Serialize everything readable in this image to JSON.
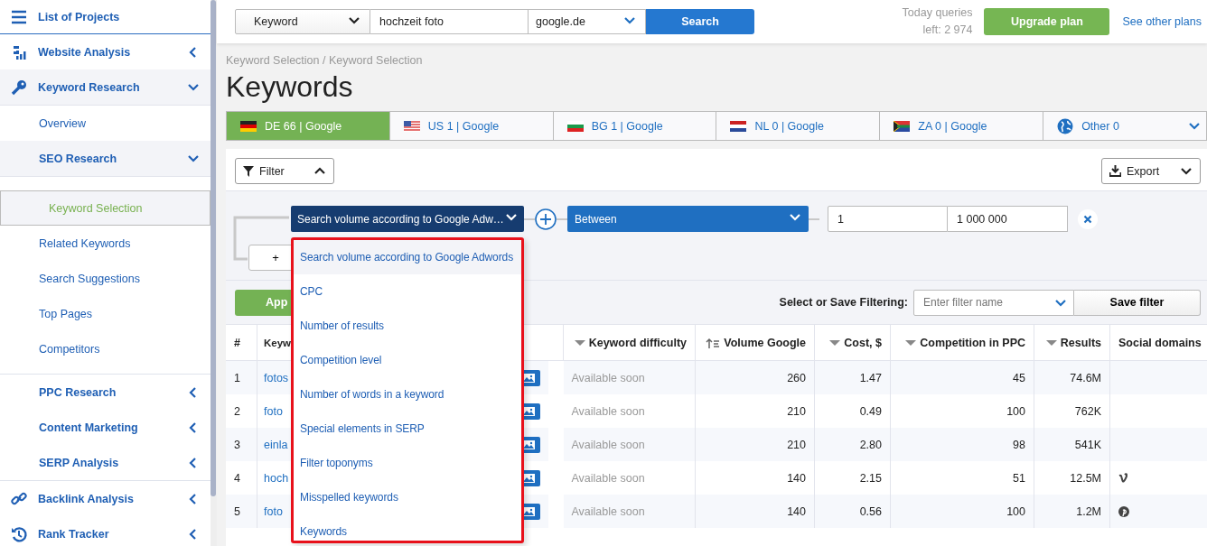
{
  "sidebar": {
    "items": [
      {
        "label": "List of Projects"
      },
      {
        "label": "Website Analysis",
        "expanded": false
      },
      {
        "label": "Keyword Research",
        "expanded": true,
        "children": [
          {
            "label": "Overview"
          },
          {
            "label": "SEO Research",
            "expanded": true,
            "children": [
              {
                "label": "Keyword Selection",
                "selected": true
              },
              {
                "label": "Related Keywords",
                "selected": false
              },
              {
                "label": "Search Suggestions",
                "selected": false
              },
              {
                "label": "Top Pages",
                "selected": false
              },
              {
                "label": "Competitors",
                "selected": false
              }
            ]
          },
          {
            "label": "PPC Research",
            "expanded": false
          },
          {
            "label": "Content Marketing",
            "expanded": false
          },
          {
            "label": "SERP Analysis",
            "expanded": false
          }
        ]
      },
      {
        "label": "Backlink Analysis",
        "expanded": false
      },
      {
        "label": "Rank Tracker",
        "expanded": false
      }
    ]
  },
  "search_bar": {
    "type_select": "Keyword",
    "query": "hochzeit foto",
    "engine": "google.de",
    "button": "Search"
  },
  "quota": {
    "line_1": "Today queries",
    "line_2": "left: 2 974"
  },
  "upgrade_button": "Upgrade plan",
  "plans_link": "See other plans",
  "breadcrumb": "Keyword Selection / Keyword Selection",
  "title": "Keywords",
  "tabs": [
    {
      "label": "DE 66 | Google",
      "selected": true
    },
    {
      "label": "US 1 | Google",
      "selected": false
    },
    {
      "label": "BG 1 | Google",
      "selected": false
    },
    {
      "label": "NL 0 | Google",
      "selected": false
    },
    {
      "label": "ZA 0 | Google",
      "selected": false
    },
    {
      "label": "Other 0",
      "selected": false
    }
  ],
  "filter_button": "Filter",
  "export_button": "Export",
  "filter_row": {
    "field": "Search volume according to Google Adw…",
    "operator": "Between",
    "from": "1",
    "to": "1 000 000",
    "add_button": "+"
  },
  "field_dropdown": {
    "options": [
      {
        "label": "Search volume according to Google Adwords",
        "selected": true
      },
      {
        "label": "CPC",
        "selected": false
      },
      {
        "label": "Number of results",
        "selected": false
      },
      {
        "label": "Competition level",
        "selected": false
      },
      {
        "label": "Number of words in a keyword",
        "selected": false
      },
      {
        "label": "Special elements in SERP",
        "selected": false
      },
      {
        "label": "Filter toponyms",
        "selected": false
      },
      {
        "label": "Misspelled keywords",
        "selected": false
      },
      {
        "label": "Keywords",
        "selected": false
      }
    ]
  },
  "apply_button": "App",
  "save_filter": {
    "label": "Select or Save Filtering:",
    "placeholder": "Enter filter name",
    "button": "Save filter"
  },
  "table": {
    "columns": [
      "#",
      "Keyw",
      "Keyword difficulty",
      "Volume Google",
      "Cost, $",
      "Competition in PPC",
      "Results",
      "Social domains"
    ],
    "rows": [
      [
        "1",
        "fotos",
        "Available soon",
        "260",
        "1.47",
        "45",
        "74.6M"
      ],
      [
        "2",
        "foto",
        "Available soon",
        "210",
        "0.49",
        "100",
        "762K"
      ],
      [
        "3",
        "einla",
        "Available soon",
        "210",
        "2.80",
        "98",
        "541K"
      ],
      [
        "4",
        "hoch",
        "Available soon",
        "140",
        "2.15",
        "51",
        "12.5M"
      ],
      [
        "5",
        "foto",
        "Available soon",
        "140",
        "0.56",
        "100",
        "1.2M"
      ]
    ]
  }
}
